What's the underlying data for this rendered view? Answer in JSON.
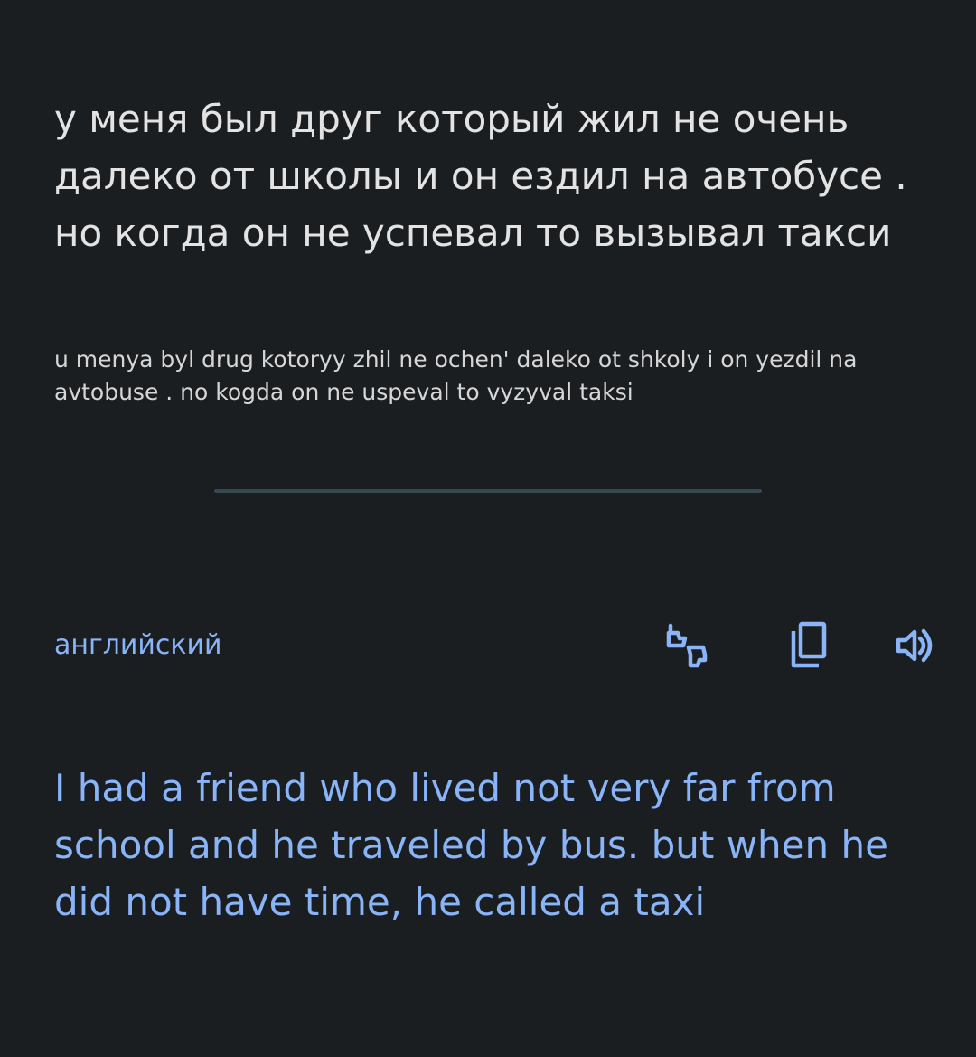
{
  "source": {
    "text": "у меня был друг который жил не очень далеко от школы и он ездил на автобусе . но когда он не успевал то вызывал такси",
    "transliteration": "u menya byl drug kotoryy zhil ne ochen' daleko ot shkoly i on yezdil na avtobuse . no kogda on ne uspeval to vyzyval taksi"
  },
  "target": {
    "language": "английский",
    "translation": "I had a friend who lived not very far from school and he traveled by bus.  but when he did not have time, he called a taxi"
  },
  "actions": {
    "feedback_icon": "thumbs-up-down-icon",
    "copy_icon": "copy-icon",
    "speak_icon": "speaker-icon"
  },
  "colors": {
    "background": "#1b1e21",
    "source_text": "#e3e3e3",
    "accent": "#8ab4f8",
    "divider": "#37474f"
  }
}
